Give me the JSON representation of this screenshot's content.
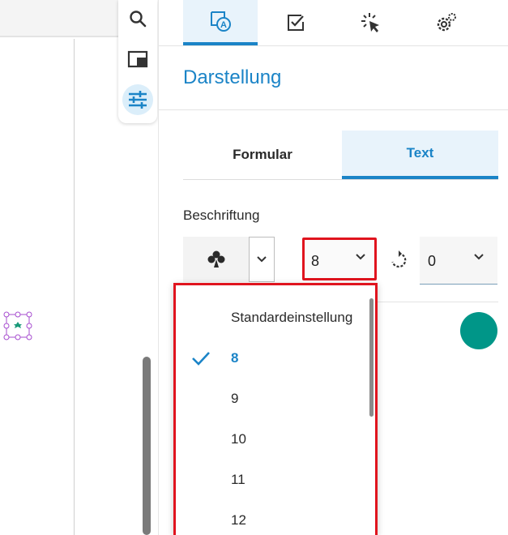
{
  "colors": {
    "accent": "#1b84c7",
    "highlight_frame": "#e0141e",
    "color_swatch": "#009688",
    "node_stroke": "#a64ccf",
    "node_center": "#1a9a7a"
  },
  "toolbar": {
    "items": [
      {
        "icon": "search-icon"
      },
      {
        "icon": "panel-icon"
      },
      {
        "icon": "sliders-icon",
        "active": true
      }
    ]
  },
  "panel": {
    "top_tabs": [
      {
        "icon": "text-style-icon",
        "active": true
      },
      {
        "icon": "checkbox-icon"
      },
      {
        "icon": "cursor-click-icon"
      },
      {
        "icon": "settings-gear-icon"
      }
    ],
    "title": "Darstellung",
    "subtabs": {
      "left": "Formular",
      "right": "Text",
      "active": "Text"
    },
    "caption_label": "Beschriftung",
    "shape_icon": "clover-icon",
    "font_size": {
      "value": "8"
    },
    "rotation": {
      "value": "0"
    },
    "color_swatch_value": "#009688"
  },
  "dropdown": {
    "options": [
      {
        "label": "Standardeinstellung",
        "selected": false
      },
      {
        "label": "8",
        "selected": true
      },
      {
        "label": "9",
        "selected": false
      },
      {
        "label": "10",
        "selected": false
      },
      {
        "label": "11",
        "selected": false
      },
      {
        "label": "12",
        "selected": false
      }
    ]
  }
}
